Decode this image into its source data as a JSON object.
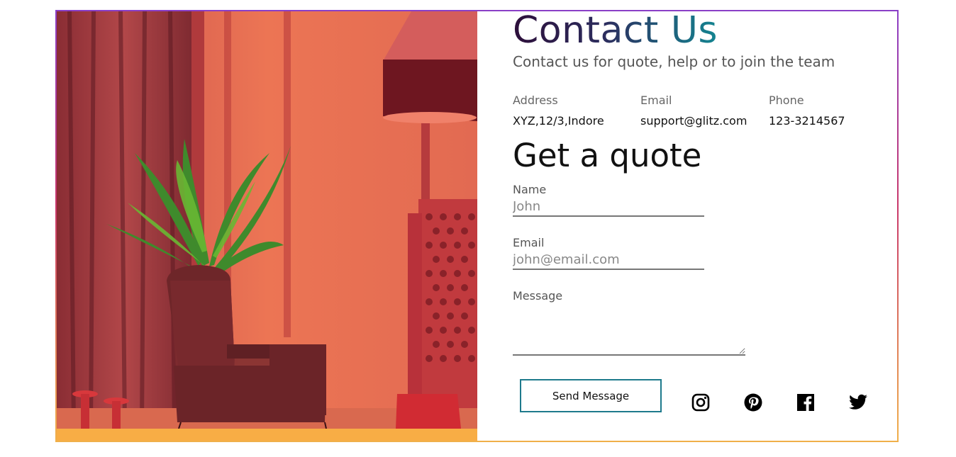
{
  "contact": {
    "title": "Contact Us",
    "subtitle": "Contact us for quote, help or to join the team"
  },
  "info": [
    {
      "label": "Address",
      "value": "XYZ,12/3,Indore"
    },
    {
      "label": "Email",
      "value": "support@glitz.com"
    },
    {
      "label": "Phone",
      "value": "123-3214567"
    }
  ],
  "quote_form": {
    "heading": "Get a quote",
    "name_label": "Name",
    "name_placeholder": "John",
    "email_label": "Email",
    "email_placeholder": "john@email.com",
    "message_label": "Message",
    "send_label": "Send Message"
  },
  "social_icons": [
    "instagram-icon",
    "pinterest-icon",
    "facebook-icon",
    "twitter-icon"
  ],
  "colors": {
    "button_border": "#1e7a8c",
    "bottom_bar": "#f8ad45",
    "title_gradient_start": "#2d0f3a",
    "title_gradient_end": "#148591"
  }
}
